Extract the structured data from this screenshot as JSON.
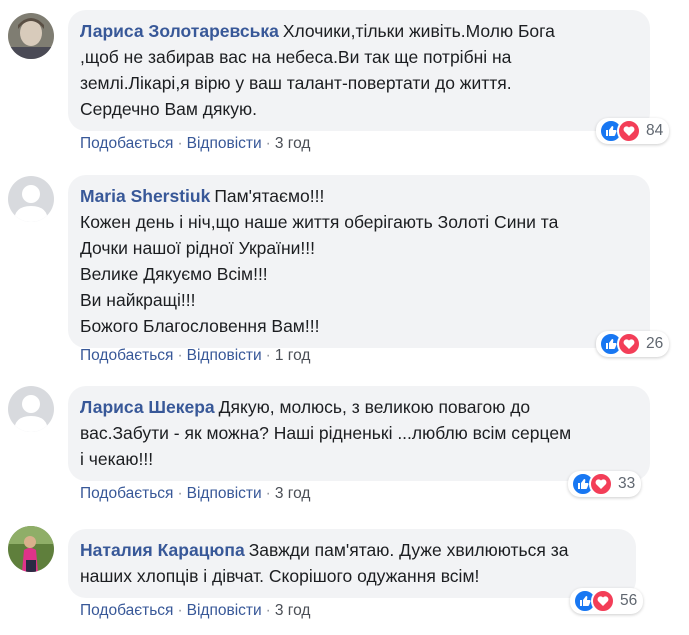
{
  "comments": [
    {
      "author": "Лариса Золотаревська",
      "text": "Хлочики,тільки живіть.Молю Бога\n,щоб не забирав вас на небеса.Ви так ще потрібні на\nземлі.Лікарі,я вірю у ваш талант-повертати до життя.\nСердечно Вам дякую.",
      "like_label": "Подобається",
      "reply_label": "Відповісти",
      "time": "3 год",
      "reactions": "84",
      "avatar": "photo"
    },
    {
      "author": "Maria Sherstiuk",
      "text": "Пам'ятаємо!!!\nКожен день і ніч,що наше життя оберігають Золоті Сини та\nДочки нашої рідної України!!!\nВелике Дякуємо Всім!!!\nВи найкращі!!!\nБожого Благословення Вам!!!",
      "like_label": "Подобається",
      "reply_label": "Відповісти",
      "time": "1 год",
      "reactions": "26",
      "avatar": "default"
    },
    {
      "author": "Лариса Шекера",
      "text": "Дякую, молюсь, з великою повагою до\nвас.Забути - як можна? Наші рідненькі ...люблю всім серцем\nі чекаю!!!",
      "like_label": "Подобається",
      "reply_label": "Відповісти",
      "time": "3 год",
      "reactions": "33",
      "avatar": "default"
    },
    {
      "author": "Наталия Карацюпа",
      "text": "Завжди пам'ятаю. Дуже хвилюються за\nнаших хлопців і дівчат. Скорішого одужання всім!",
      "like_label": "Подобається",
      "reply_label": "Відповісти",
      "time": "3 год",
      "reactions": "56",
      "avatar": "photo"
    }
  ],
  "colors": {
    "author": "#385898",
    "bubble": "#f2f3f5",
    "like": "#1877f2",
    "love": "#f33e58"
  },
  "icons": {
    "like": "thumbs-up-icon",
    "love": "heart-icon"
  }
}
